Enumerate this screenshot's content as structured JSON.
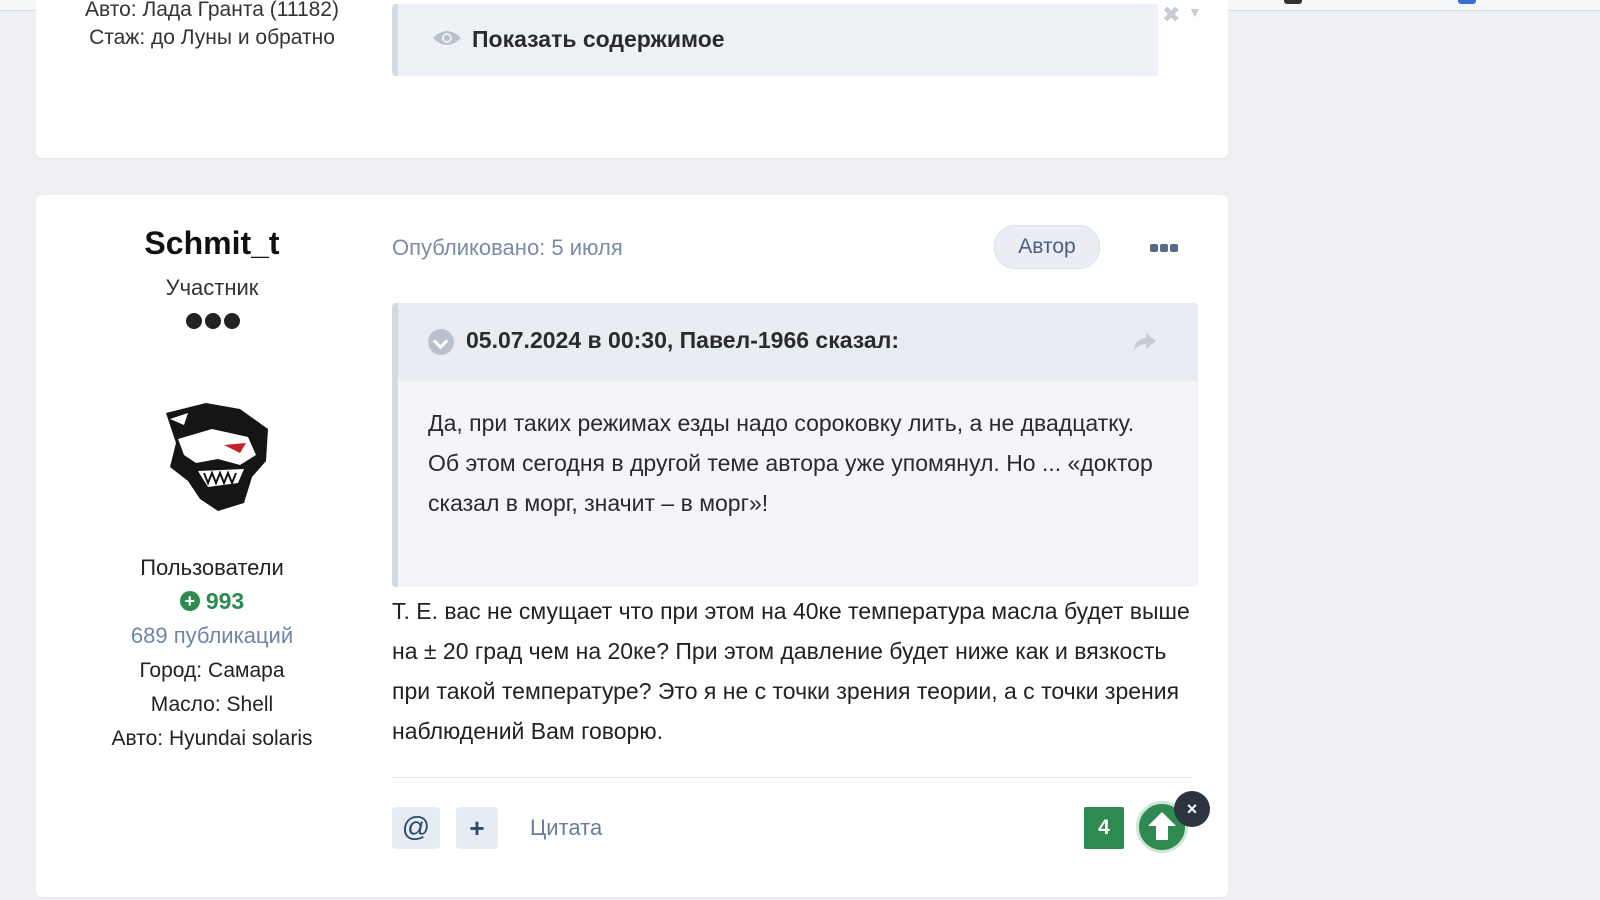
{
  "colors": {
    "accent_green": "#2f8a51",
    "link_blue": "#6f86a8",
    "quote_bg": "#f3f5f9",
    "page_bg": "#eef0f4"
  },
  "prev_post": {
    "author_car_cutoff": "Авто: Лада Гранта (11182)",
    "experience": "Стаж: до Луны и обратно",
    "spoiler": {
      "icon": "eye-icon",
      "label": "Показать содержимое"
    }
  },
  "post": {
    "author": {
      "username": "Schmit_t",
      "rank": "Участник",
      "group": "Пользователи",
      "reputation": "993",
      "posts_count": "689 публикаций",
      "fields": [
        {
          "label": "Город:",
          "value": "Самара"
        },
        {
          "label": "Масло:",
          "value": "Shell"
        },
        {
          "label": "Авто:",
          "value": "Hyundai solaris"
        }
      ]
    },
    "meta": {
      "published": "Опубликовано: 5 июля",
      "author_badge": "Автор"
    },
    "quote": {
      "citation": "05.07.2024 в 00:30, Павел-1966 сказал:",
      "text": "Да, при таких режимах езды надо сороковку лить, а не двадцатку. Об этом сегодня в другой теме автора уже упомянул. Но ... «доктор сказал в морг, значит – в морг»!"
    },
    "body": "Т. Е. вас не смущает что при этом на 40ке температура масла будет выше на ± 20 град чем на 20ке? При этом давление будет ниже как и вязкость при такой температуре? Это я не с точки зрения теории, а с точки зрения наблюдений Вам говорю.",
    "actions": {
      "mention": "@",
      "multiquote": "+",
      "quote": "Цитата",
      "reaction_count": "4",
      "close": "×"
    }
  }
}
